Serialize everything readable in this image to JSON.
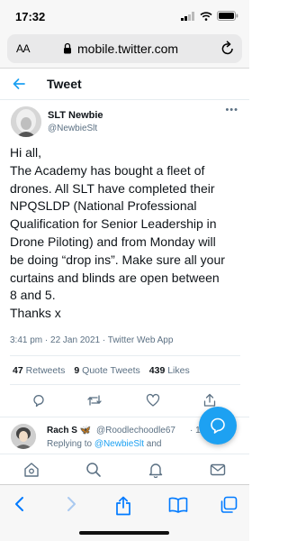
{
  "status_bar": {
    "time": "17:32"
  },
  "browser": {
    "aa_label": "AA",
    "url": "mobile.twitter.com"
  },
  "header": {
    "title": "Tweet"
  },
  "tweet": {
    "author_name": "SLT Newbie",
    "author_handle": "@NewbieSlt",
    "more_label": "•••",
    "lines": [
      "Hi all,",
      "The Academy has bought a fleet of",
      "drones. All SLT have completed their",
      "NPQSLDP (National Professional",
      "Qualification for Senior Leadership in",
      "Drone Piloting) and from Monday will",
      "be doing “drop ins”. Make sure all your",
      "curtains and blinds are open between",
      "8 and 5.",
      "Thanks x"
    ],
    "meta": "3:41 pm · 22 Jan 2021 · Twitter Web App",
    "retweets_count": "47",
    "retweets_label": "Retweets",
    "quotes_count": "9",
    "quotes_label": "Quote Tweets",
    "likes_count": "439",
    "likes_label": "Likes"
  },
  "reply": {
    "name": "Rach S 🦋",
    "handle": "@Roodlechoodle67",
    "time": "· 1h",
    "replying_prefix": "Replying to ",
    "replying_to": "@NewbieSlt",
    "replying_suffix": " and"
  },
  "icons": {
    "home": "home-icon",
    "explore": "search-icon",
    "notifications": "bell-icon",
    "messages": "mail-icon"
  },
  "colors": {
    "twitter_blue": "#1da1f2",
    "ios_blue": "#007aff"
  }
}
